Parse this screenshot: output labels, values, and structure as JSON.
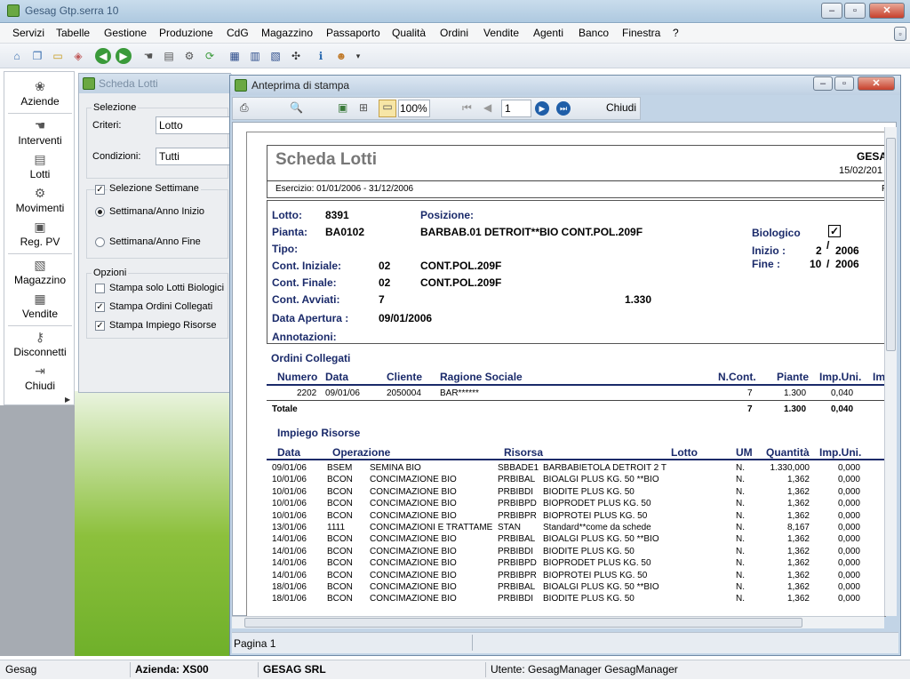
{
  "app": {
    "title": "Gesag Gtp.serra 10"
  },
  "menu": [
    "Servizi",
    "Tabelle",
    "Gestione",
    "Produzione",
    "CdG",
    "Magazzino",
    "Passaporto",
    "Qualità",
    "Ordini",
    "Vendite",
    "Agenti",
    "Banco",
    "Finestra",
    "?"
  ],
  "sidebar": {
    "items": [
      "Aziende",
      "Interventi",
      "Lotti",
      "Movimenti",
      "Reg. PV",
      "Magazzino",
      "Vendite",
      "Disconnetti",
      "Chiudi"
    ]
  },
  "scheda": {
    "title": "Scheda Lotti",
    "selezione_label": "Selezione",
    "criteri_label": "Criteri:",
    "criteri_value": "Lotto",
    "condizioni_label": "Condizioni:",
    "condizioni_value": "Tutti",
    "settimane_label": "Selezione Settimane",
    "radio_inizio": "Settimana/Anno Inizio",
    "radio_fine": "Settimana/Anno Fine",
    "opzioni_label": "Opzioni",
    "opt1": "Stampa solo Lotti Biologici",
    "opt2": "Stampa Ordini Collegati",
    "opt3": "Stampa Impiego Risorse"
  },
  "preview": {
    "title": "Anteprima di stampa",
    "zoom": "100%",
    "page": "1",
    "close_label": "Chiudi",
    "status": "Pagina 1"
  },
  "report": {
    "title": "Scheda Lotti",
    "company": "GESA",
    "date": "15/02/201",
    "esercizio": "Esercizio: 01/01/2006 - 31/12/2006",
    "pg": "P",
    "lotto_label": "Lotto:",
    "lotto": "8391",
    "posizione_label": "Posizione:",
    "pianta_label": "Pianta:",
    "pianta": "BA0102",
    "pianta_desc": "BARBAB.01 DETROIT**BIO CONT.POL.209F",
    "biologico_label": "Biologico",
    "biologico_check": "✓",
    "tipo_label": "Tipo:",
    "inizio_label": "Inizio :",
    "inizio_week": "2",
    "inizio_slash": "/",
    "inizio_year": "2006",
    "fine_label": "Fine :",
    "fine_week": "10",
    "fine_slash": "/",
    "fine_year": "2006",
    "cont_iniziale_label": "Cont. Iniziale:",
    "cont_iniziale": "02",
    "cont_iniziale_desc": "CONT.POL.209F",
    "cont_finale_label": "Cont. Finale:",
    "cont_finale": "02",
    "cont_finale_desc": "CONT.POL.209F",
    "cont_avviati_label": "Cont. Avviati:",
    "cont_avviati": "7",
    "cont_avviati_total": "1.330",
    "data_apertura_label": "Data Apertura :",
    "data_apertura": "09/01/2006",
    "annotazioni_label": "Annotazioni:",
    "ordini_title": "Ordini Collegati",
    "ordini_headers": [
      "Numero",
      "Data",
      "Cliente",
      "Ragione Sociale",
      "N.Cont.",
      "Piante",
      "Imp.Uni.",
      "Im"
    ],
    "ordini_row": [
      "2202",
      "09/01/06",
      "2050004",
      "BAR******",
      "7",
      "1.300",
      "0,040"
    ],
    "totale_label": "Totale",
    "totale": [
      "7",
      "1.300",
      "0,040"
    ],
    "impiego_title": "Impiego Risorse",
    "impiego_headers": [
      "Data",
      "Operazione",
      "Risorsa",
      "Lotto",
      "UM",
      "Quantità",
      "Imp.Uni."
    ],
    "impiego_rows": [
      [
        "09/01/06",
        "BSEM",
        "SEMINA BIO",
        "SBBADE1",
        "BARBABIETOLA DETROIT 2 T",
        "N.",
        "1.330,000",
        "0,000"
      ],
      [
        "10/01/06",
        "BCON",
        "CONCIMAZIONE BIO",
        "PRBIBAL",
        "BIOALGI PLUS KG. 50 **BIO",
        "N.",
        "1,362",
        "0,000"
      ],
      [
        "10/01/06",
        "BCON",
        "CONCIMAZIONE BIO",
        "PRBIBDI",
        "BIODITE PLUS KG. 50",
        "N.",
        "1,362",
        "0,000"
      ],
      [
        "10/01/06",
        "BCON",
        "CONCIMAZIONE BIO",
        "PRBIBPD",
        "BIOPRODET PLUS KG. 50",
        "N.",
        "1,362",
        "0,000"
      ],
      [
        "10/01/06",
        "BCON",
        "CONCIMAZIONE BIO",
        "PRBIBPR",
        "BIOPROTEI PLUS KG. 50",
        "N.",
        "1,362",
        "0,000"
      ],
      [
        "13/01/06",
        "1111",
        "CONCIMAZIONI E TRATTAME",
        "STAN",
        "Standard**come da schede",
        "N.",
        "8,167",
        "0,000"
      ],
      [
        "14/01/06",
        "BCON",
        "CONCIMAZIONE BIO",
        "PRBIBAL",
        "BIOALGI PLUS KG. 50 **BIO",
        "N.",
        "1,362",
        "0,000"
      ],
      [
        "14/01/06",
        "BCON",
        "CONCIMAZIONE BIO",
        "PRBIBDI",
        "BIODITE PLUS KG. 50",
        "N.",
        "1,362",
        "0,000"
      ],
      [
        "14/01/06",
        "BCON",
        "CONCIMAZIONE BIO",
        "PRBIBPD",
        "BIOPRODET PLUS KG. 50",
        "N.",
        "1,362",
        "0,000"
      ],
      [
        "14/01/06",
        "BCON",
        "CONCIMAZIONE BIO",
        "PRBIBPR",
        "BIOPROTEI PLUS KG. 50",
        "N.",
        "1,362",
        "0,000"
      ],
      [
        "18/01/06",
        "BCON",
        "CONCIMAZIONE BIO",
        "PRBIBAL",
        "BIOALGI PLUS KG. 50 **BIO",
        "N.",
        "1,362",
        "0,000"
      ],
      [
        "18/01/06",
        "BCON",
        "CONCIMAZIONE BIO",
        "PRBIBDI",
        "BIODITE PLUS KG. 50",
        "N.",
        "1,362",
        "0,000"
      ]
    ]
  },
  "status": {
    "app": "Gesag",
    "azienda": "Azienda: XS00",
    "company": "GESAG SRL",
    "utente": "Utente: GesagManager GesagManager"
  }
}
